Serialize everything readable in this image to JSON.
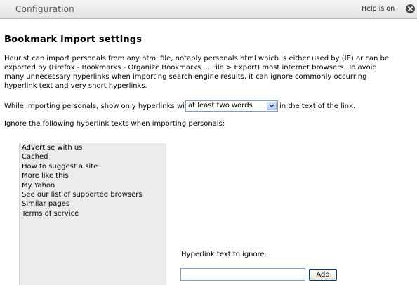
{
  "window": {
    "title": "Configuration",
    "help_toggle": "Help is on",
    "close_icon": "close-icon"
  },
  "main": {
    "heading": "Bookmark import settings",
    "description": "Heurist can import personals from any html file, notably personals.html which is either used by (IE) or can be exported by (Firefox - Bookmarks - Organize Bookmarks ... File > Export) most internet browsers. To avoid many unnecessary hyperlinks when importing search engine results, it can ignore commonly occurring hyperlink text and very short hyperlinks.",
    "filter": {
      "label_before": "While importing personals, show only hyperlinks with",
      "selected": "at least two words",
      "label_after": "in the text of the link."
    },
    "ignore_label": "Ignore the following hyperlink texts when importing personals:",
    "ignore_items": [
      "Advertise with us",
      "Cached",
      "How to suggest a site",
      "More like this",
      "My Yahoo",
      "See our list of supported browsers",
      "Similar pages",
      "Terms of service"
    ],
    "hyperlink_label": "Hyperlink text to ignore:",
    "hyperlink_value": "",
    "add_label": "Add"
  }
}
